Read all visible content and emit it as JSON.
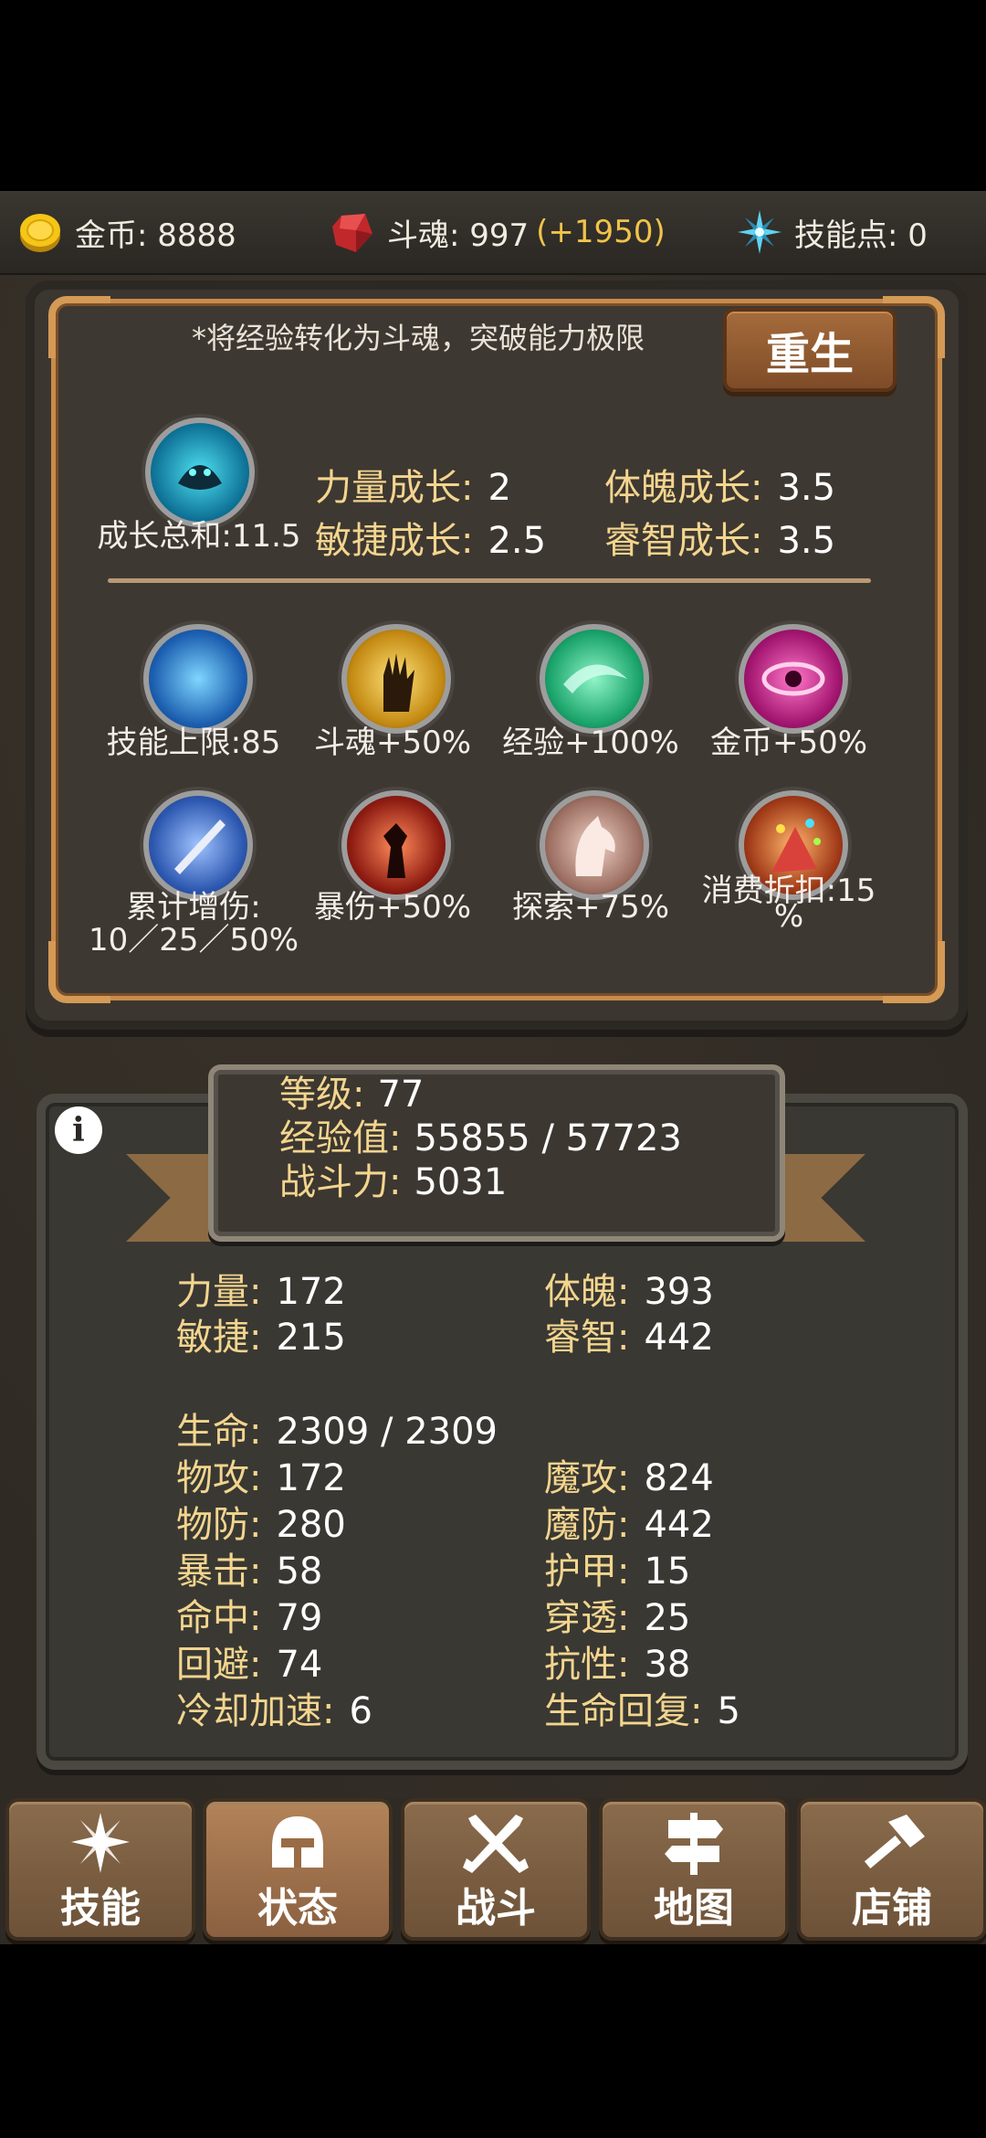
{
  "topbar": {
    "gold_label": "金币: 8888",
    "soul_label": "斗魂: 997",
    "soul_bonus": "(+1950)",
    "skill_points_label": "技能点: 0"
  },
  "rebirth_panel": {
    "notice": "*将经验转化为斗魂，突破能力极限",
    "rebirth_button": "重生",
    "growth_total": "成长总和:11.5",
    "growth": [
      {
        "label": "力量成长:",
        "value": "2"
      },
      {
        "label": "体魄成长:",
        "value": "3.5"
      },
      {
        "label": "敏捷成长:",
        "value": "2.5"
      },
      {
        "label": "睿智成长:",
        "value": "3.5"
      }
    ],
    "perks": [
      {
        "label": "技能上限:85",
        "icon": "skill-limit-icon"
      },
      {
        "label": "斗魂+50%",
        "icon": "soul-hand-icon"
      },
      {
        "label": "经验+100%",
        "icon": "experience-icon"
      },
      {
        "label": "金币+50%",
        "icon": "gold-eye-icon"
      },
      {
        "label": "累计增伤:",
        "label2": "10／25／50%",
        "icon": "cumulative-damage-icon"
      },
      {
        "label": "暴伤+50%",
        "icon": "crit-damage-icon"
      },
      {
        "label": "探索+75%",
        "icon": "explore-horse-icon"
      },
      {
        "label": "消费折扣:15",
        "label2": "%",
        "icon": "discount-icon"
      }
    ]
  },
  "status": {
    "level_label": "等级:",
    "level": "77",
    "exp_label": "经验值:",
    "exp": "55855 / 57723",
    "power_label": "战斗力:",
    "power": "5031",
    "info_icon": "i",
    "left": [
      {
        "label": "力量:",
        "value": "172"
      },
      {
        "label": "敏捷:",
        "value": "215"
      }
    ],
    "right": [
      {
        "label": "体魄:",
        "value": "393"
      },
      {
        "label": "睿智:",
        "value": "442"
      }
    ],
    "hp_label": "生命:",
    "hp": "2309 / 2309",
    "combat_left": [
      {
        "label": "物攻:",
        "value": "172"
      },
      {
        "label": "物防:",
        "value": "280"
      },
      {
        "label": "暴击:",
        "value": "58"
      },
      {
        "label": "命中:",
        "value": "79"
      },
      {
        "label": "回避:",
        "value": "74"
      },
      {
        "label": "冷却加速:",
        "value": "6"
      }
    ],
    "combat_right": [
      {
        "label": "魔攻:",
        "value": "824"
      },
      {
        "label": "魔防:",
        "value": "442"
      },
      {
        "label": "护甲:",
        "value": "15"
      },
      {
        "label": "穿透:",
        "value": "25"
      },
      {
        "label": "抗性:",
        "value": "38"
      },
      {
        "label": "生命回复:",
        "value": "5"
      }
    ]
  },
  "nav": [
    {
      "label": "技能",
      "icon": "sparkle-icon"
    },
    {
      "label": "状态",
      "icon": "helmet-icon",
      "active": true
    },
    {
      "label": "战斗",
      "icon": "crossed-swords-icon"
    },
    {
      "label": "地图",
      "icon": "signpost-icon"
    },
    {
      "label": "店铺",
      "icon": "hammer-icon"
    }
  ]
}
